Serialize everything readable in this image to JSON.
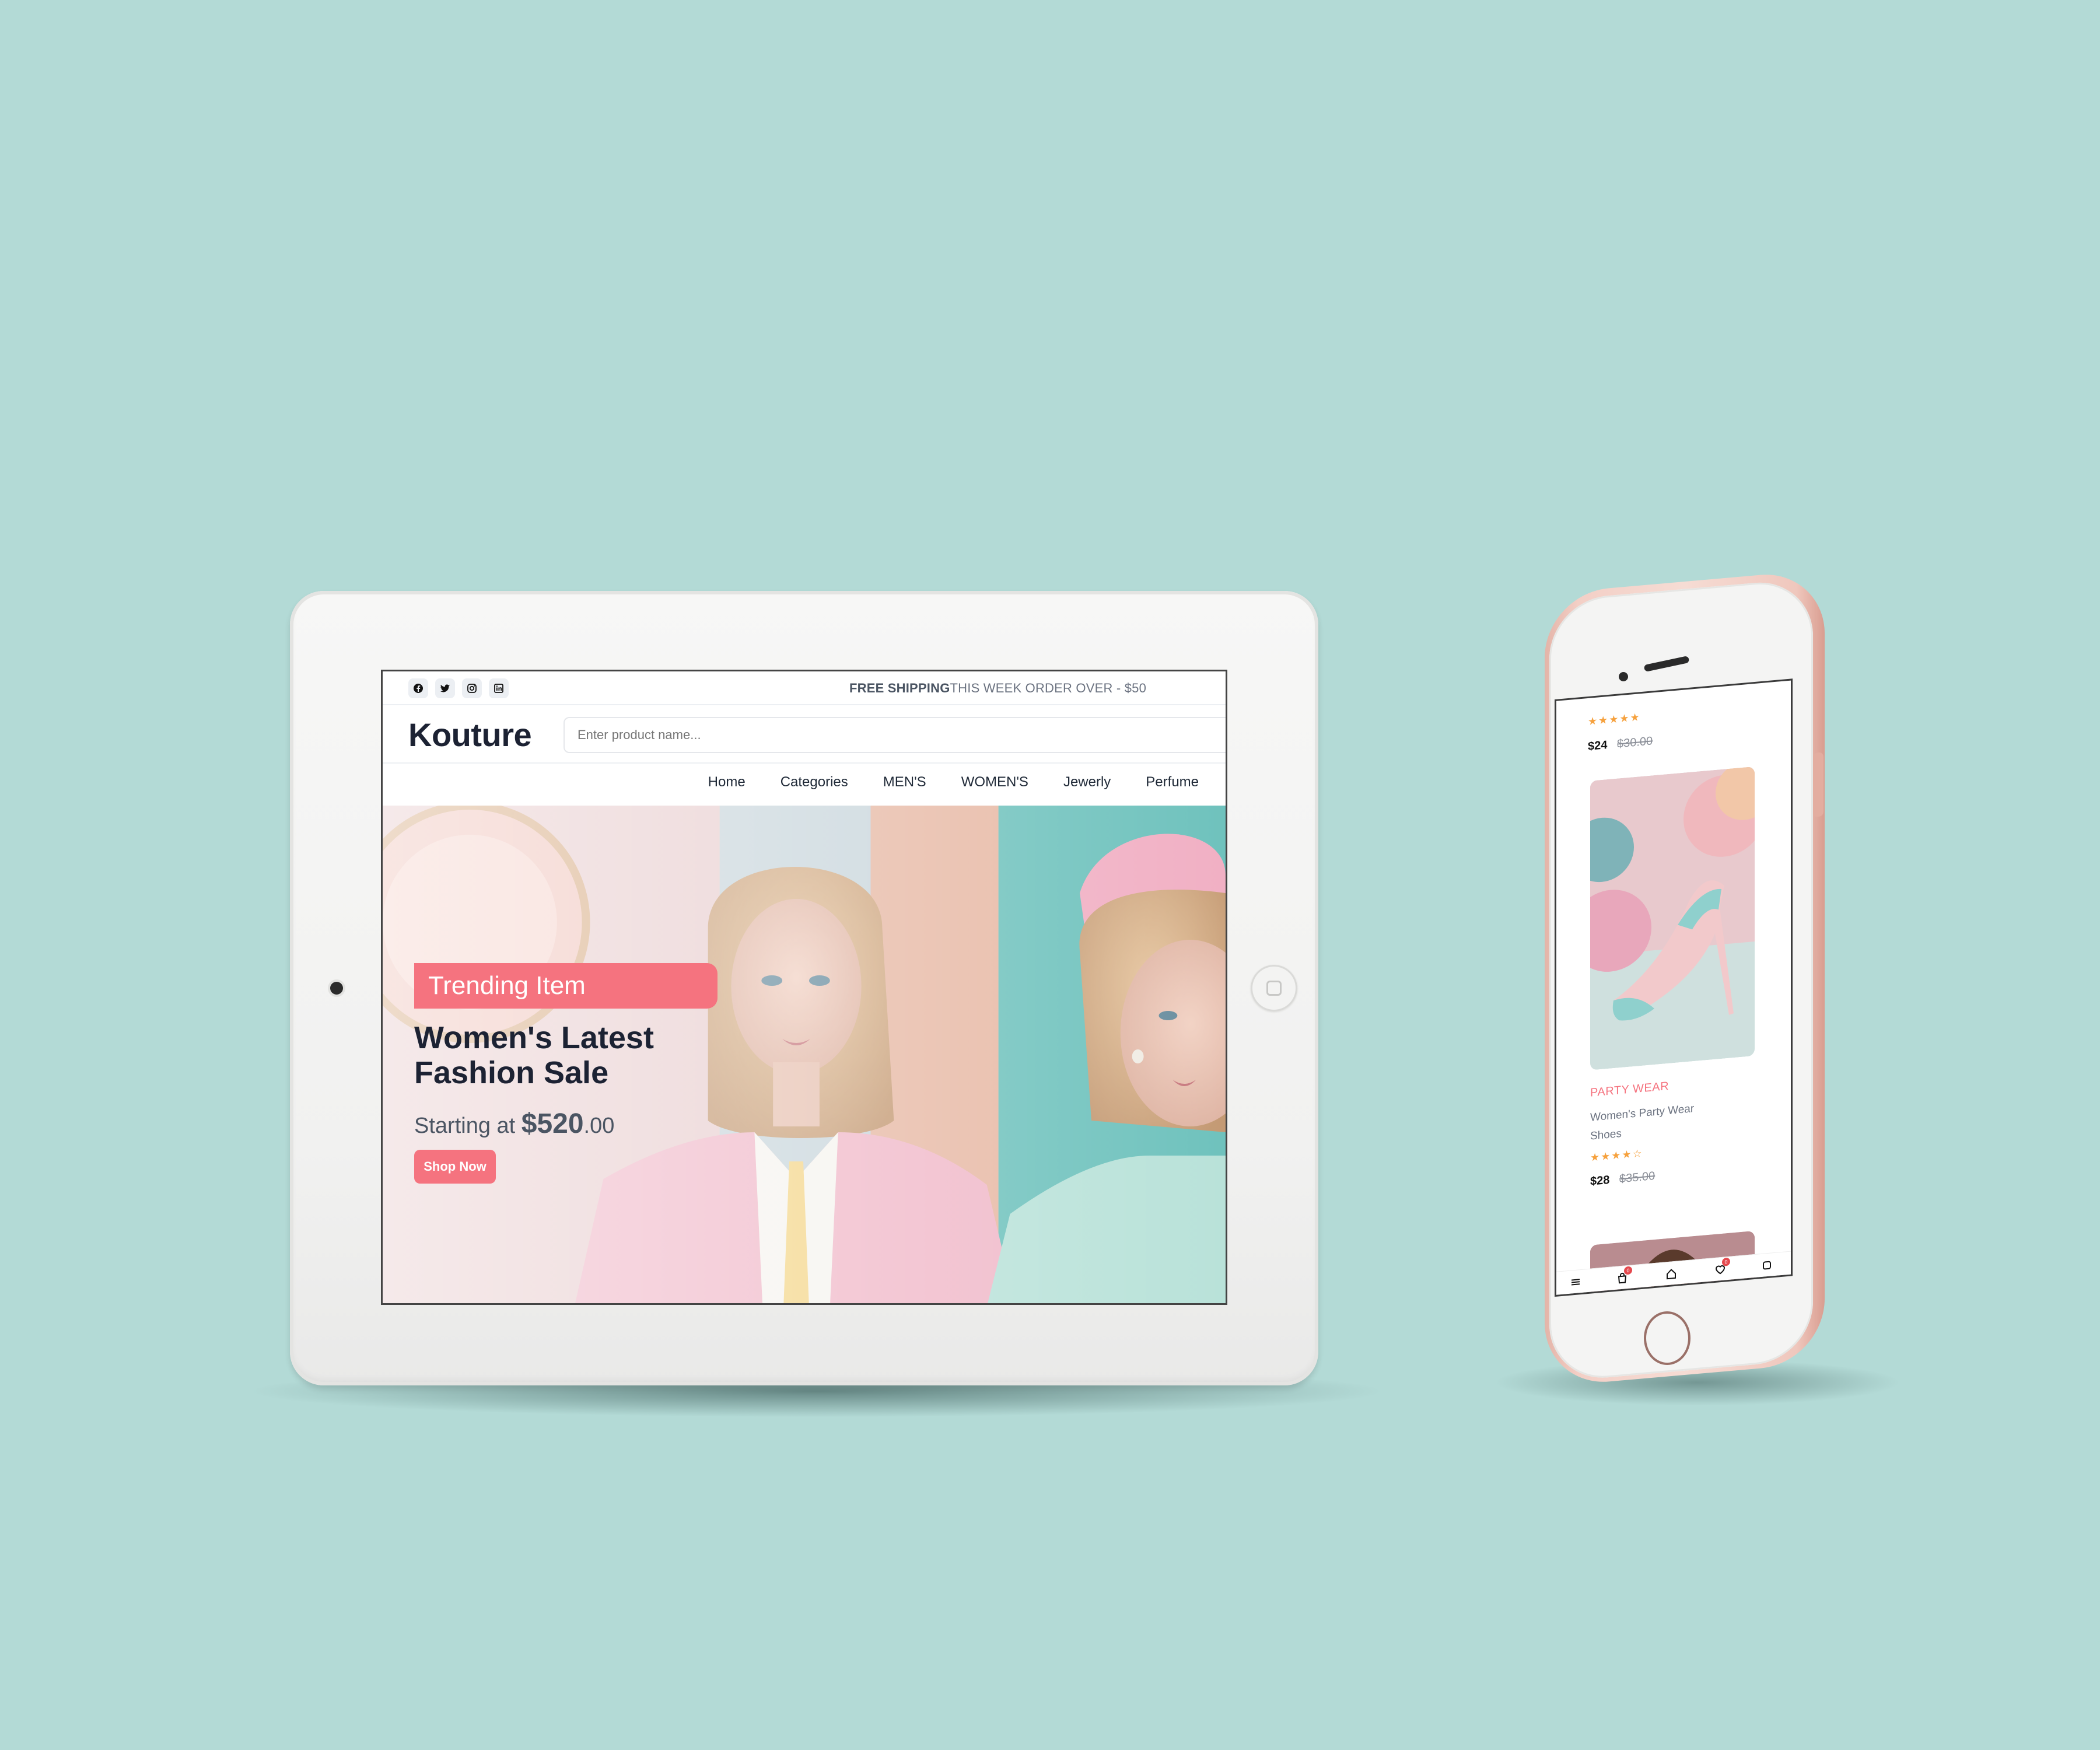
{
  "tablet": {
    "social_icons": [
      "facebook-icon",
      "twitter-icon",
      "instagram-icon",
      "linkedin-icon"
    ],
    "shipping_bold": "FREE SHIPPING",
    "shipping_text": "THIS WEEK ORDER OVER - $50",
    "logo": "Kouture",
    "search_placeholder": "Enter product name...",
    "nav": [
      "Home",
      "Categories",
      "MEN'S",
      "WOMEN'S",
      "Jewerly",
      "Perfume"
    ],
    "hero": {
      "badge": "Trending Item",
      "title": "Women's Latest Fashion Sale",
      "price_prefix": "Starting at ",
      "price_main": "$520",
      "price_cents": ".00",
      "button": "Shop Now"
    }
  },
  "phone": {
    "top_stars": "★★★★★",
    "top_price": "$24",
    "top_old_price": "$30.00",
    "product": {
      "category": "PARTY WEAR",
      "name": "Women's Party Wear Shoes",
      "stars": "★★★★☆",
      "price": "$28",
      "old_price": "$35.00"
    },
    "bottom_nav_icons": [
      "menu-icon",
      "bag-icon",
      "home-icon",
      "heart-icon",
      "grid-icon"
    ],
    "badge_count": "0"
  },
  "colors": {
    "background": "#b3dad6",
    "accent": "#f5737f",
    "text_dark": "#1c2233",
    "star": "#f6a13d"
  }
}
